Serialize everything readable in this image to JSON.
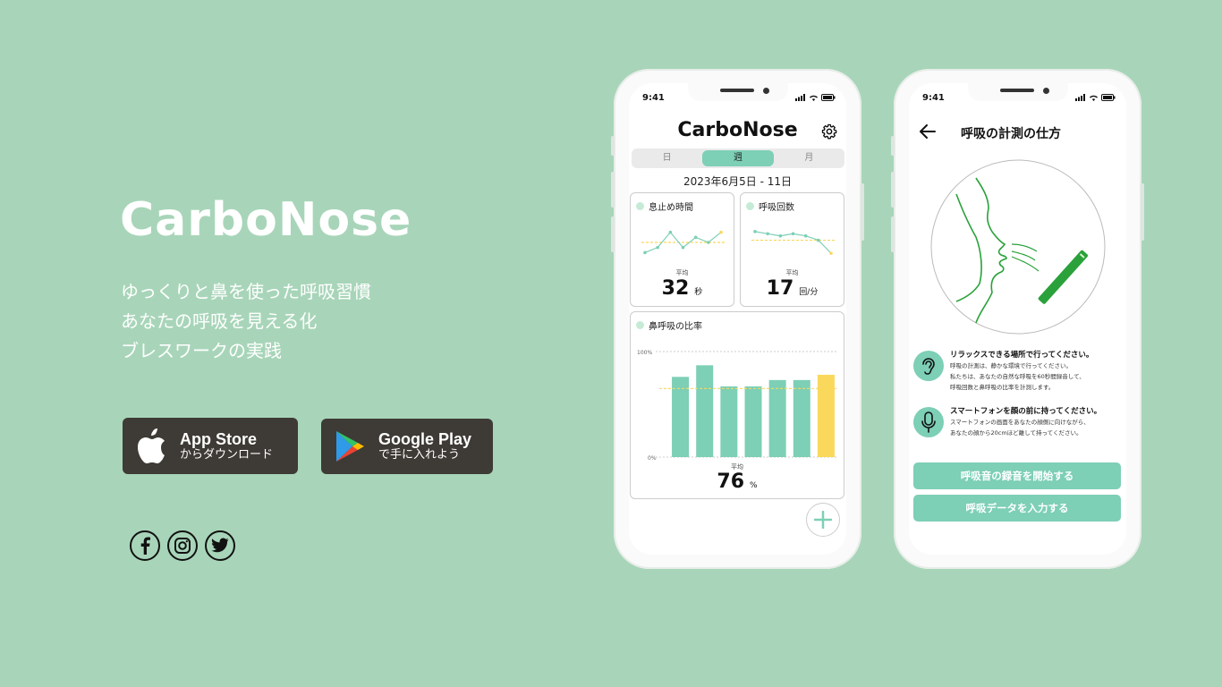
{
  "hero": {
    "app_name": "CarboNose",
    "taglines": [
      "ゆっくりと鼻を使った呼吸習慣",
      "あなたの呼吸を見える化",
      "ブレスワークの実践"
    ],
    "app_store": {
      "line1": "App Store",
      "line2": "からダウンロード"
    },
    "google_play": {
      "line1": "Google Play",
      "line2": "で手に入れよう"
    },
    "social_icons": [
      "facebook-icon",
      "instagram-icon",
      "twitter-icon"
    ]
  },
  "status_bar": {
    "time": "9:41"
  },
  "screen1": {
    "title": "CarboNose",
    "tabs": [
      {
        "label": "日",
        "active": false
      },
      {
        "label": "週",
        "active": true
      },
      {
        "label": "月",
        "active": false
      }
    ],
    "date_range": "2023年6月5日 - 11日",
    "breath_hold": {
      "label": "息止め時間",
      "avg_label": "平均",
      "avg_value": "32",
      "unit": "秒",
      "chart_data": {
        "type": "line",
        "values": [
          30,
          31,
          34,
          31,
          33,
          32,
          34
        ],
        "avg": 32,
        "last_highlight": true
      }
    },
    "breath_rate": {
      "label": "呼吸回数",
      "avg_label": "平均",
      "avg_value": "17",
      "unit": "回/分",
      "chart_data": {
        "type": "line",
        "values": [
          19,
          18.5,
          18,
          18.5,
          18,
          17,
          14
        ],
        "avg": 17,
        "last_highlight": true
      }
    },
    "nasal_ratio": {
      "label": "鼻呼吸の比率",
      "avg_label": "平均",
      "avg_value": "76",
      "unit": "%",
      "chart_data": {
        "type": "bar",
        "ylim": [
          0,
          100
        ],
        "y_ticks": [
          "100%",
          "0%"
        ],
        "values": [
          76,
          87,
          67,
          67,
          73,
          73,
          78
        ],
        "avg": 65,
        "highlight_last": true,
        "bar_color": "#7dcfb6",
        "highlight_color": "#f9d85b"
      }
    }
  },
  "screen2": {
    "title": "呼吸の計測の仕方",
    "tips": [
      {
        "icon": "ear-icon",
        "title": "リラックスできる場所で行ってください。",
        "body": [
          "呼吸の計測は、静かな環境で行ってください。",
          "私たちは、あなたの自然な呼吸を60秒間録音して、",
          "呼吸回数と鼻呼吸の比率を計測します。"
        ]
      },
      {
        "icon": "microphone-icon",
        "title": "スマートフォンを顔の前に持ってください。",
        "body": [
          "スマートフォンの画面をあなたの顔側に向けながら、",
          "あなたの顔から20cmほど離して持ってください。"
        ]
      }
    ],
    "btn_record": "呼吸音の録音を開始する",
    "btn_input": "呼吸データを入力する"
  },
  "colors": {
    "background": "#a8d5b9",
    "accent": "#7dcfb6",
    "highlight": "#f9d85b",
    "store_badge": "#3e3a35"
  }
}
